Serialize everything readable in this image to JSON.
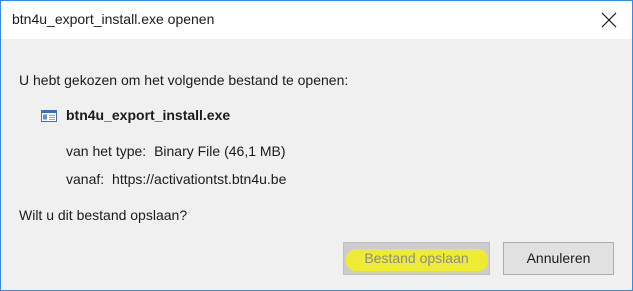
{
  "window": {
    "title": "btn4u_export_install.exe openen",
    "close_icon": "close-icon"
  },
  "dialog": {
    "intro": "U hebt gekozen om het volgende bestand te openen:",
    "file_icon": "exe-file-icon",
    "filename": "btn4u_export_install.exe",
    "type_label": "van het type:",
    "type_value": "Binary File (46,1 MB)",
    "from_label": "vanaf:",
    "from_value": "https://activationtst.btn4u.be",
    "question": "Wilt u dit bestand opslaan?"
  },
  "buttons": {
    "save_label": "Bestand opslaan",
    "cancel_label": "Annuleren"
  },
  "colors": {
    "window_border": "#3c8ad8",
    "body_background": "#f0f0f0",
    "highlight": "#f3f01a"
  }
}
